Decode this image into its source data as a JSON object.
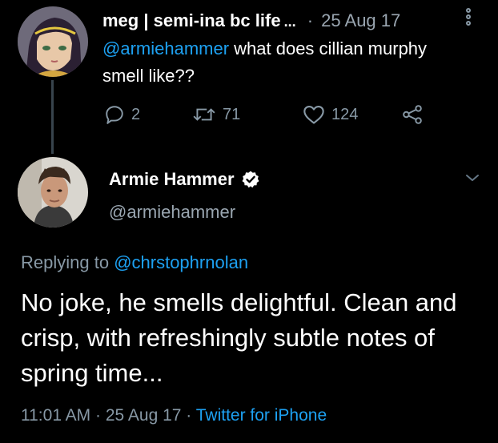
{
  "tweet1": {
    "display_name": "meg | semi-ina bc life",
    "truncation": "...",
    "date_sep": "·",
    "date": "25 Aug 17",
    "mention": "@armiehammer",
    "text_rest": " what does cillian murphy smell like??",
    "reply_count": "2",
    "retweet_count": "71",
    "like_count": "124",
    "icons": [
      "reply-icon",
      "retweet-icon",
      "like-icon",
      "share-icon",
      "more-icon"
    ]
  },
  "tweet2": {
    "display_name": "Armie Hammer",
    "handle": "@armiehammer",
    "verified_icon": "verified-badge-icon",
    "replying_prefix": "Replying to ",
    "replying_to": "@chrstophrnolan",
    "text": "No joke, he smells delightful. Clean and crisp, with refreshingly subtle notes of spring time...",
    "time": "11:01 AM",
    "sep1": " · ",
    "date": "25 Aug 17",
    "sep2": " · ",
    "source": "Twitter for iPhone"
  },
  "colors": {
    "background": "#000000",
    "text": "#ffffff",
    "muted": "#8899a6",
    "link": "#1da1f2",
    "thread_line": "#38444d"
  }
}
